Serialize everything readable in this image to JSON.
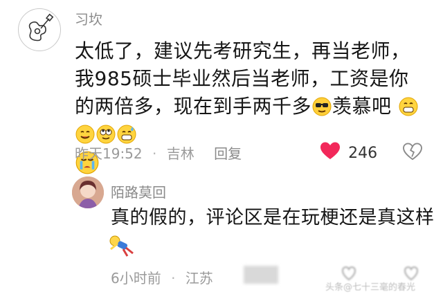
{
  "main_comment": {
    "username": "习坎",
    "text_before_emoji": "太低了，建议先考研究生，再当老师，我985硕士毕业然后当老师，工资是你的两倍多，现在到手两千多",
    "text_after_emoji": "羡慕吧",
    "emoji_inline": "cool-face-emoji",
    "emoji_trailing": [
      "grin-emoji",
      "smile-emoji",
      "rolling-eyes-emoji",
      "sweat-grin-emoji",
      "crying-emoji"
    ],
    "time": "昨天19:52",
    "separator": "·",
    "location": "吉林",
    "reply_label": "回复",
    "like_count": "246",
    "like_color": "#f2285a"
  },
  "reply_comment": {
    "username": "陌路莫回",
    "text": "真的假的，评论区是在玩梗还是真这样",
    "sticker": "falling-figure-sticker",
    "time": "6小时前",
    "separator": "·",
    "location": "江苏"
  },
  "watermark": "头条@七十三毫的春光"
}
